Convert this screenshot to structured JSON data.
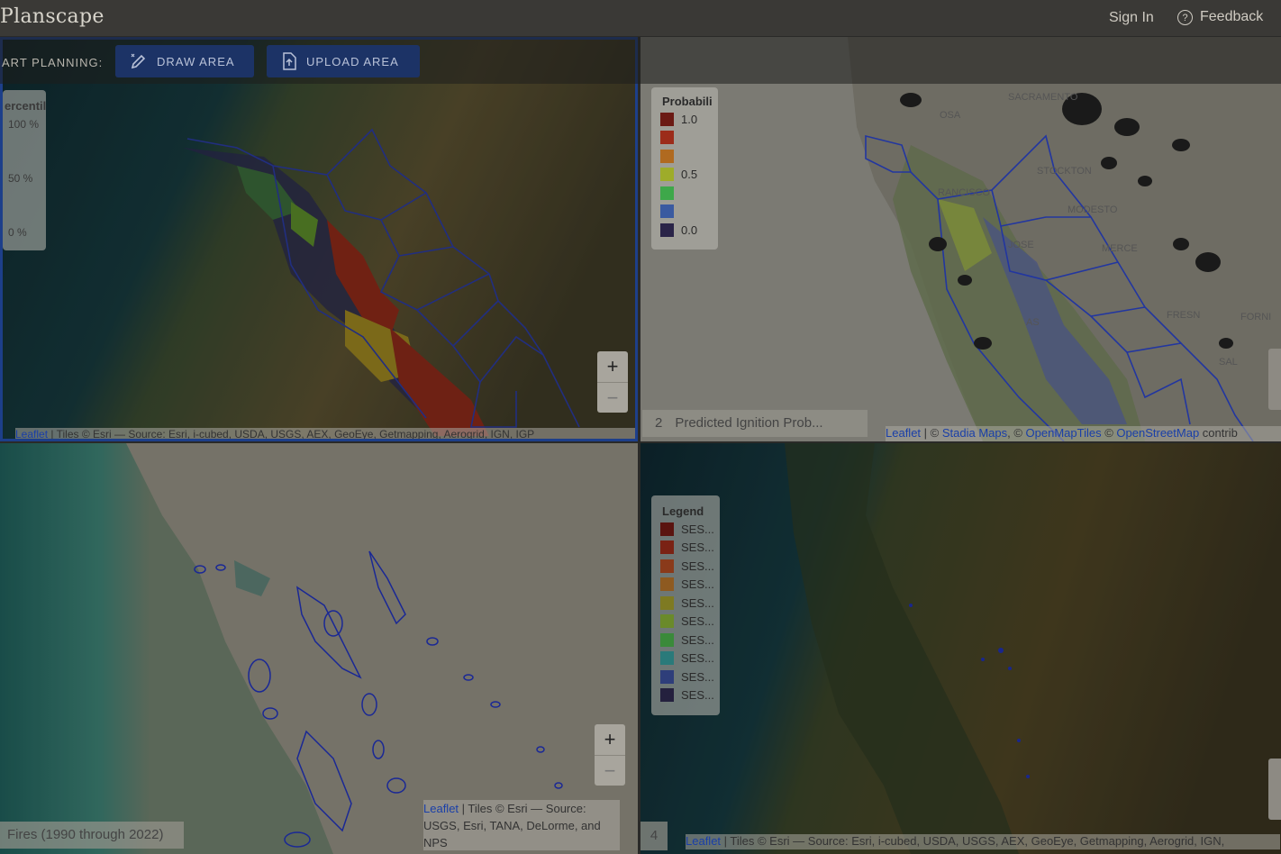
{
  "header": {
    "brand": "Planscape",
    "sign_in": "Sign In",
    "feedback": "Feedback"
  },
  "toolbar": {
    "planning_label": "ART PLANNING:",
    "draw_area": "DRAW AREA",
    "upload_area": "UPLOAD AREA"
  },
  "map1": {
    "legend_title": "ercentil",
    "legend_labels": [
      "100 %",
      "50 %",
      "0 %"
    ],
    "zoom_in": "+",
    "zoom_out": "−",
    "attribution_leaflet": "Leaflet",
    "attribution_text": " | Tiles © Esri — Source: Esri, i-cubed, USDA, USGS, AEX, GeoEye, Getmapping, Aerogrid, IGN, IGP"
  },
  "map2": {
    "legend_title": "Probabili",
    "legend_labels": [
      "1.0",
      "0.5",
      "0.0"
    ],
    "legend_colors": [
      "#6b1a14",
      "#9c2c1a",
      "#b06a20",
      "#9eac2a",
      "#3ea84a",
      "#3a5aa0",
      "#2a2448"
    ],
    "layer_index": "2",
    "layer_name": "Predicted Ignition Prob...",
    "attribution_leaflet": "Leaflet",
    "attribution_sep1": " | © ",
    "attribution_stadia": "Stadia Maps",
    "attribution_sep2": ", © ",
    "attribution_omt": "OpenMapTiles",
    "attribution_sep3": " © ",
    "attribution_osm": "OpenStreetMap",
    "attribution_end": " contrib",
    "city_labels": [
      "SACRAMENTO",
      "OSA",
      "STOCKTON",
      "RANCISCO",
      "MODESTO",
      "MERCE",
      "JOSE",
      "FRESN",
      "FORNI",
      "AS",
      "SAL"
    ]
  },
  "map3": {
    "layer_name": "Fires (1990 through 2022)",
    "zoom_in": "+",
    "zoom_out": "−",
    "attribution_leaflet": "Leaflet",
    "attribution_line1": " | Tiles © Esri — Source:",
    "attribution_line2": "USGS, Esri, TANA, DeLorme, and",
    "attribution_line3": "NPS"
  },
  "map4": {
    "legend_title": "Legend",
    "legend_items": [
      "SES...",
      "SES...",
      "SES...",
      "SES...",
      "SES...",
      "SES...",
      "SES...",
      "SES...",
      "SES...",
      "SES..."
    ],
    "legend_colors": [
      "#5a1410",
      "#7a2214",
      "#8a3a1a",
      "#8e5a20",
      "#7e7a22",
      "#6a8a2a",
      "#3a8a3a",
      "#2a7a7a",
      "#2e3e7a",
      "#24203e"
    ],
    "layer_index": "4",
    "attribution_leaflet": "Leaflet",
    "attribution_text": " | Tiles © Esri — Source: Esri, i-cubed, USDA, USGS, AEX, GeoEye, Getmapping, Aerogrid, IGN, "
  }
}
